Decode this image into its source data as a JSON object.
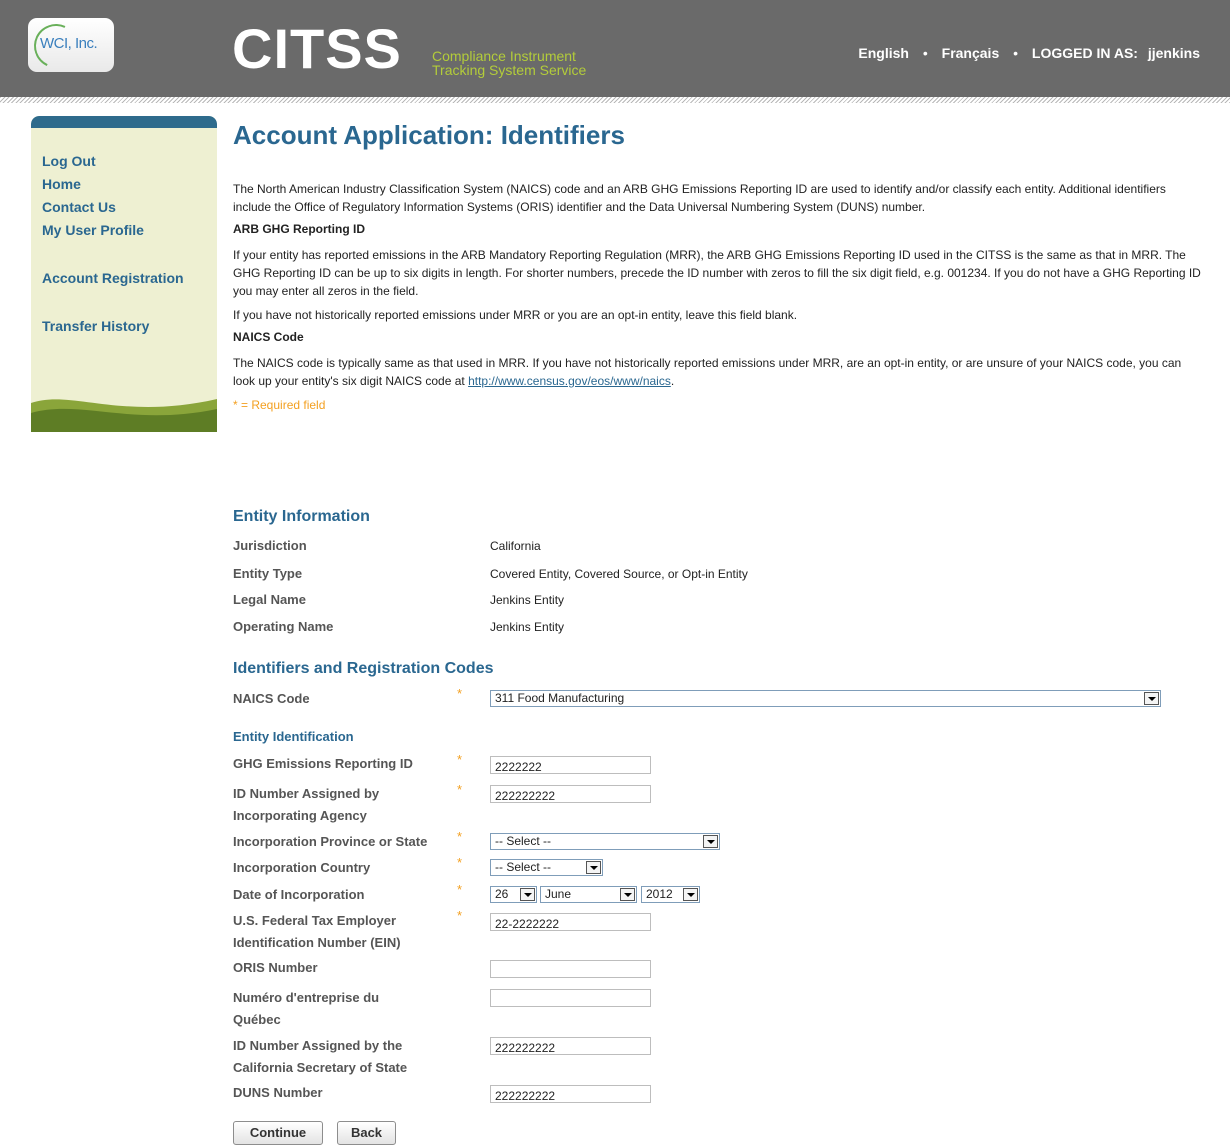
{
  "header": {
    "logo_text": "WCI, Inc.",
    "brand": "CITSS",
    "brand_sub_line1": "Compliance Instrument",
    "brand_sub_line2": "Tracking System Service",
    "lang_english": "English",
    "lang_french": "Français",
    "separator": "•",
    "logged_in_label": "LOGGED IN AS:",
    "username": "jjenkins"
  },
  "sidebar": {
    "items": [
      {
        "label": "Log Out"
      },
      {
        "label": "Home"
      },
      {
        "label": "Contact Us"
      },
      {
        "label": "My User Profile"
      },
      {
        "label": "Account Registration"
      },
      {
        "label": "Transfer History"
      }
    ]
  },
  "intro": {
    "title": "Account Application: Identifiers",
    "p1": "The North American Industry Classification System (NAICS) code and an ARB GHG Emissions Reporting ID are used to identify and/or classify each entity. Additional identifiers include the Office of Regulatory Information Systems (ORIS) identifier and the Data Universal Numbering System (DUNS) number.",
    "h_ghg": "ARB GHG Reporting ID",
    "p2": "If your entity has reported emissions in the ARB Mandatory Reporting Regulation (MRR), the ARB GHG Emissions Reporting ID used in the CITSS is the same as that in MRR. The GHG Reporting ID can be up to six digits in length. For shorter numbers, precede the ID number with zeros to fill the six digit field, e.g. 001234. If you do not have a GHG Reporting ID you may enter all zeros in the field.",
    "p3": "If you have not historically reported emissions under MRR or you are an opt-in entity, leave this field blank.",
    "h_naics": "NAICS Code",
    "p4_before": "The NAICS code is typically same as that used in MRR. If you have not historically reported emissions under MRR, are an opt-in entity, or are unsure of your NAICS code, you can look up your entity's six digit NAICS code at ",
    "p4_link": "http://www.census.gov/eos/www/naics",
    "p4_after": ".",
    "required_note": "* = Required field"
  },
  "entity_info": {
    "title": "Entity Information",
    "rows": [
      {
        "label": "Jurisdiction",
        "value": "California"
      },
      {
        "label": "Entity Type",
        "value": "Covered Entity, Covered Source, or Opt-in Entity"
      },
      {
        "label": "Legal Name",
        "value": "Jenkins Entity"
      },
      {
        "label": "Operating Name",
        "value": "Jenkins Entity"
      }
    ]
  },
  "identifiers": {
    "title": "Identifiers and Registration Codes",
    "star": "*",
    "naics_label": "NAICS Code",
    "naics_value": "311 Food Manufacturing",
    "entity_identification": "Entity Identification",
    "ghg_label": "GHG Emissions Reporting ID",
    "ghg_value": "2222222",
    "agency_label_1": "ID Number Assigned by",
    "agency_label_2": "Incorporating Agency",
    "agency_value": "222222222",
    "province_label": "Incorporation Province or State",
    "province_value": "-- Select --",
    "country_label": "Incorporation Country",
    "country_value": "-- Select --",
    "date_label": "Date of Incorporation",
    "date_day": "26",
    "date_month": "June",
    "date_year": "2012",
    "ein_label_1": "U.S. Federal Tax Employer",
    "ein_label_2": "Identification Number (EIN)",
    "ein_value": "22-2222222",
    "oris_label": "ORIS Number",
    "oris_value": "",
    "quebec_label_1": "Numéro d'entreprise du",
    "quebec_label_2": "Québec",
    "quebec_value": "",
    "ca_sos_label_1": "ID Number Assigned by the",
    "ca_sos_label_2": "California Secretary of State",
    "ca_sos_value": "222222222",
    "duns_label": "DUNS Number",
    "duns_value": "222222222"
  },
  "buttons": {
    "continue": "Continue",
    "back": "Back"
  }
}
